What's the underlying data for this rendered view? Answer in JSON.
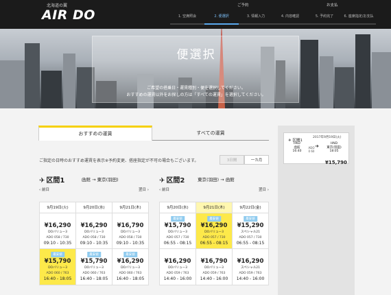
{
  "header": {
    "brand_sub": "北海道の翼",
    "logo": "AIR DO",
    "top_labels": [
      "ご予約",
      "お支払"
    ],
    "steps": [
      "1. 空席照会",
      "2. 便選択",
      "3. 情報入力",
      "4. 内容確認",
      "5. 予約完了",
      "6. 座席指定/お支払"
    ],
    "active_step": 1
  },
  "hero": {
    "title": "便選択",
    "line1": "ご希望の搭乗日・運賃種別・便を選択してください。",
    "line2": "おすすめの運賃以外をお探しの方は「すべての運賃」を選択してください。"
  },
  "tabs": {
    "recommended": "おすすめの運賃",
    "all": "すべての運賃"
  },
  "note": "ご指定の日時のおすすめ運賃を表示※予約変更、搭座指定が不可の場合もございます。",
  "segment_toggle": {
    "three_days": "3日間",
    "one_month": "一カ月"
  },
  "sections": [
    {
      "title": "区間1",
      "from": "函館",
      "to": "東京(羽田)",
      "prev": "前日",
      "next": "翌日",
      "dates": [
        "9月19日(火)",
        "9月20日(水)",
        "9月21日(木)"
      ],
      "selected_date": -1,
      "rows": [
        [
          {
            "badge": "",
            "price": "¥16,290",
            "fare": "DOバリュー3",
            "flight": "ADO 058 / 730",
            "time": "09:10 - 10:35",
            "highlight": false
          },
          {
            "badge": "",
            "price": "¥16,290",
            "fare": "DOバリュー3",
            "flight": "ADO 058 / 730",
            "time": "09:10 - 10:35",
            "highlight": false
          },
          {
            "badge": "",
            "price": "¥16,790",
            "fare": "DOバリュー3",
            "flight": "ADO 058 / 730",
            "time": "09:10 - 10:35",
            "highlight": false
          }
        ],
        [
          {
            "badge": "最安値",
            "price": "¥15,790",
            "fare": "DOバリュー3",
            "flight": "ADO 060 / 763",
            "time": "16:40 - 18:05",
            "highlight": true
          },
          {
            "badge": "最安値",
            "price": "¥15,790",
            "fare": "DOバリュー3",
            "flight": "ADO 060 / 763",
            "time": "16:40 - 18:05",
            "highlight": false
          },
          {
            "badge": "最安値",
            "price": "¥16,290",
            "fare": "DOバリュー3",
            "flight": "ADO 060 / 763",
            "time": "16:40 - 18:05",
            "highlight": false
          }
        ]
      ]
    },
    {
      "title": "区間2",
      "from": "東京(羽田)",
      "to": "函館",
      "prev": "前日",
      "next": "翌日",
      "dates": [
        "9月20日(水)",
        "9月21日(木)",
        "9月22日(金)"
      ],
      "selected_date": 1,
      "rows": [
        [
          {
            "badge": "最安値",
            "price": "¥15,790",
            "fare": "DOバリュー3",
            "flight": "ADO 057 / 730",
            "time": "06:55 - 08:15",
            "highlight": false
          },
          {
            "badge": "最安値",
            "price": "¥16,290",
            "fare": "DOバリュー3",
            "flight": "ADO 057 / 730",
            "time": "06:55 - 08:15",
            "highlight": true
          },
          {
            "badge": "最安値",
            "price": "¥15,290",
            "fare": "スペシャル21",
            "flight": "ADO 057 / 730",
            "time": "06:55 - 08:15",
            "highlight": false
          }
        ],
        [
          {
            "badge": "",
            "price": "¥16,290",
            "fare": "DOバリュー3",
            "flight": "ADO 059 / 763",
            "time": "14:40 - 16:00",
            "highlight": false
          },
          {
            "badge": "",
            "price": "¥16,790",
            "fare": "DOバリュー3",
            "flight": "ADO 059 / 763",
            "time": "14:40 - 16:00",
            "highlight": false
          },
          {
            "badge": "",
            "price": "¥16,290",
            "fare": "スペシャル21",
            "flight": "ADO 059 / 763",
            "time": "14:40 - 16:00",
            "highlight": false
          }
        ]
      ]
    }
  ],
  "summary": {
    "label": "区間1",
    "date": "2017年9月19日(火)",
    "dep_code": "HKD",
    "dep_city": "函館",
    "dep_time": "16:40",
    "flight": "ADO 0 60",
    "arr_code": "HND",
    "arr_city": "東京(羽田)",
    "arr_time": "18:05",
    "price": "¥15,790"
  },
  "colors": {
    "highlight": "#fde94a",
    "badge": "#8fcbef",
    "tab_accent": "#f5d000",
    "header_bg": "#1b1b1b"
  }
}
